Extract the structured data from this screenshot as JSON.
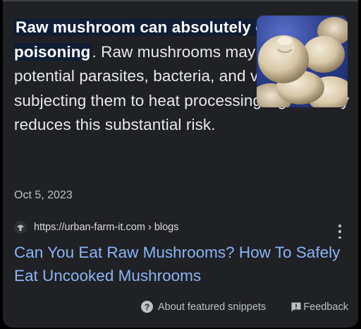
{
  "snippet": {
    "highlight": "Raw mushroom can absolutely cause food poisoning",
    "body": ". Raw mushrooms may contain potential parasites, bacteria, and viruses, and subjecting them to heat processing significantly reduces this substantial risk.",
    "date": "Oct 5, 2023"
  },
  "image": {
    "alt": "White raw mushrooms on a blue background"
  },
  "source": {
    "url": "https://urban-farm-it.com › blogs",
    "favicon": "mushroom-favicon-icon",
    "menu_icon": "more-vert-icon"
  },
  "result": {
    "title": "Can You Eat Raw Mushrooms? How To Safely Eat Uncooked Mushrooms"
  },
  "footer": {
    "about_label": "About featured snippets",
    "about_icon": "help-icon",
    "feedback_label": "Feedback",
    "feedback_icon": "feedback-icon"
  },
  "colors": {
    "background": "#202124",
    "highlight_bg": "#0f1e35",
    "link": "#8ab4f8",
    "text": "#e8eaed"
  }
}
